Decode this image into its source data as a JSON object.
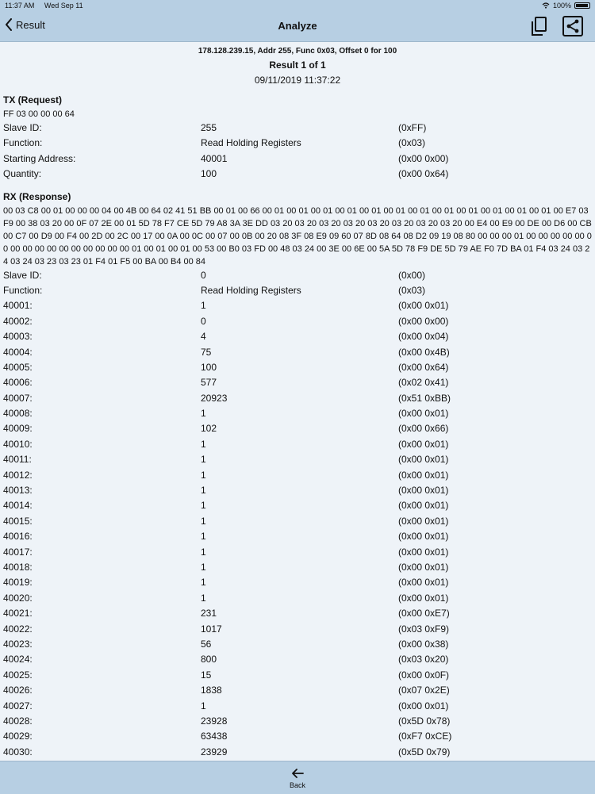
{
  "status": {
    "time": "11:37 AM",
    "date": "Wed Sep 11",
    "battery": "100%"
  },
  "nav": {
    "back_label": "Result",
    "title": "Analyze"
  },
  "header": {
    "address_line": "178.128.239.15, Addr 255, Func  0x03, Offset 0 for 100",
    "result_line": "Result 1 of 1",
    "datetime": "09/11/2019 11:37:22"
  },
  "tx": {
    "title": "TX (Request)",
    "raw": "FF 03 00 00 00 64",
    "rows": [
      [
        "Slave ID:",
        "255",
        "(0xFF)"
      ],
      [
        "Function:",
        "Read Holding Registers",
        "(0x03)"
      ],
      [
        "Starting Address:",
        "40001",
        "(0x00 0x00)"
      ],
      [
        "Quantity:",
        "100",
        "(0x00 0x64)"
      ]
    ]
  },
  "rx": {
    "title": "RX (Response)",
    "raw": "00 03 C8 00 01 00 00 00 04 00 4B 00 64 02 41 51 BB 00 01 00 66 00 01 00 01 00 01 00 01 00 01 00 01 00 01 00 01 00 01 00 01 00 01 00 01 00 E7 03 F9 00 38 03 20 00 0F 07 2E 00 01 5D 78 F7 CE 5D 79 A8 3A 3E DD 03 20 03 20 03 20 03 20 03 20 03 20 03 20 03 20 00 E4 00 E9 00 DE 00 D6 00 CB 00 C7 00 D9 00 F4 00 2D 00 2C 00 17 00 0A 00 0C 00 07 00 0B 00 20 08 3F 08 E9 09 60 07 8D 08 64 08 D2 09 19 08 80 00 00 00 01 00 00 00 00 00 00 00 00 00 00 00 00 00 00 00 00 01 00 01 00 01 00 53 00 B0 03 FD 00 48 03 24 00 3E 00 6E 00 5A 5D 78 F9 DE 5D 79 AE F0 7D BA 01 F4 03 24 03 24 03 24 03 23 03 23 01 F4 01 F5 00 BA 00 B4 00 84",
    "rows": [
      [
        "Slave ID:",
        "0",
        "(0x00)"
      ],
      [
        "Function:",
        "Read Holding Registers",
        "(0x03)"
      ],
      [
        "40001:",
        "1",
        "(0x00 0x01)"
      ],
      [
        "40002:",
        "0",
        "(0x00 0x00)"
      ],
      [
        "40003:",
        "4",
        "(0x00 0x04)"
      ],
      [
        "40004:",
        "75",
        "(0x00 0x4B)"
      ],
      [
        "40005:",
        "100",
        "(0x00 0x64)"
      ],
      [
        "40006:",
        "577",
        "(0x02 0x41)"
      ],
      [
        "40007:",
        "20923",
        "(0x51 0xBB)"
      ],
      [
        "40008:",
        "1",
        "(0x00 0x01)"
      ],
      [
        "40009:",
        "102",
        "(0x00 0x66)"
      ],
      [
        "40010:",
        "1",
        "(0x00 0x01)"
      ],
      [
        "40011:",
        "1",
        "(0x00 0x01)"
      ],
      [
        "40012:",
        "1",
        "(0x00 0x01)"
      ],
      [
        "40013:",
        "1",
        "(0x00 0x01)"
      ],
      [
        "40014:",
        "1",
        "(0x00 0x01)"
      ],
      [
        "40015:",
        "1",
        "(0x00 0x01)"
      ],
      [
        "40016:",
        "1",
        "(0x00 0x01)"
      ],
      [
        "40017:",
        "1",
        "(0x00 0x01)"
      ],
      [
        "40018:",
        "1",
        "(0x00 0x01)"
      ],
      [
        "40019:",
        "1",
        "(0x00 0x01)"
      ],
      [
        "40020:",
        "1",
        "(0x00 0x01)"
      ],
      [
        "40021:",
        "231",
        "(0x00 0xE7)"
      ],
      [
        "40022:",
        "1017",
        "(0x03 0xF9)"
      ],
      [
        "40023:",
        "56",
        "(0x00 0x38)"
      ],
      [
        "40024:",
        "800",
        "(0x03 0x20)"
      ],
      [
        "40025:",
        "15",
        "(0x00 0x0F)"
      ],
      [
        "40026:",
        "1838",
        "(0x07 0x2E)"
      ],
      [
        "40027:",
        "1",
        "(0x00 0x01)"
      ],
      [
        "40028:",
        "23928",
        "(0x5D 0x78)"
      ],
      [
        "40029:",
        "63438",
        "(0xF7 0xCE)"
      ],
      [
        "40030:",
        "23929",
        "(0x5D 0x79)"
      ]
    ]
  },
  "bottom": {
    "back_label": "Back"
  }
}
